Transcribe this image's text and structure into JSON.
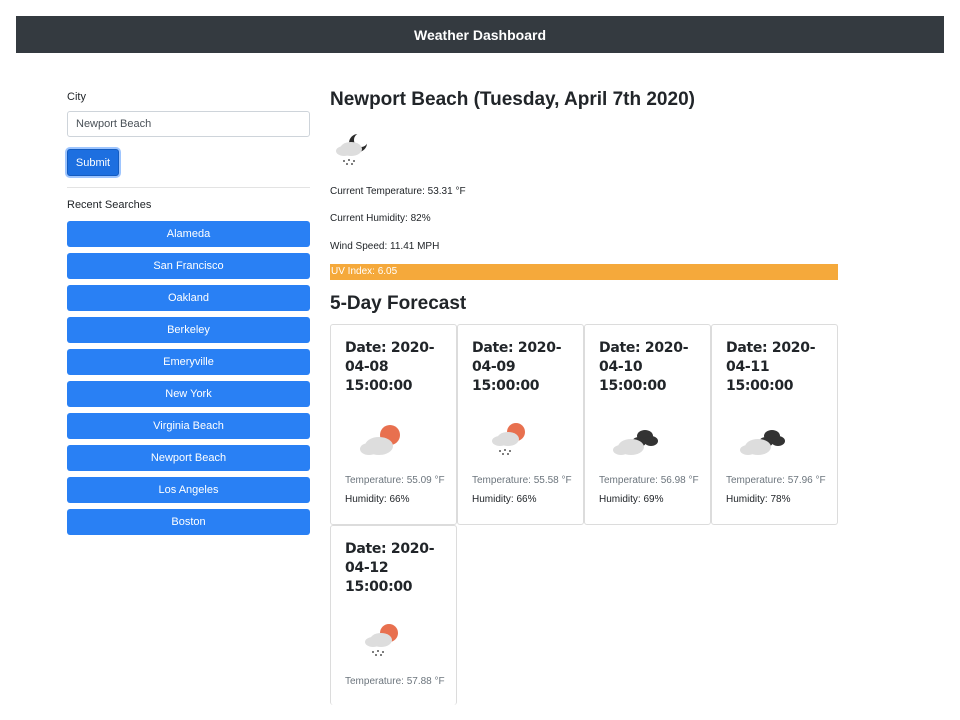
{
  "navbar": {
    "title": "Weather Dashboard"
  },
  "search": {
    "label": "City",
    "value": "Newport Beach",
    "submit_label": "Submit",
    "recent_title": "Recent Searches",
    "recent": [
      "Alameda",
      "San Francisco",
      "Oakland",
      "Berkeley",
      "Emeryville",
      "New York",
      "Virginia Beach",
      "Newport Beach",
      "Los Angeles",
      "Boston"
    ]
  },
  "current": {
    "title": "Newport Beach (Tuesday, April 7th 2020)",
    "icon": "rain-cloud-night-icon",
    "temperature": "Current Temperature: 53.31 °F",
    "humidity": "Current Humidity: 82%",
    "wind": "Wind Speed: 11.41 MPH",
    "uv": "UV Index: 6.05"
  },
  "forecast": {
    "title": "5-Day Forecast",
    "days": [
      {
        "date": "Date: 2020-04-08 15:00:00",
        "icon": "partly-cloudy-icon",
        "temp": "Temperature: 55.09 °F",
        "humidity": "Humidity: 66%"
      },
      {
        "date": "Date: 2020-04-09 15:00:00",
        "icon": "rain-cloud-sun-icon",
        "temp": "Temperature: 55.58 °F",
        "humidity": "Humidity: 66%"
      },
      {
        "date": "Date: 2020-04-10 15:00:00",
        "icon": "broken-clouds-icon",
        "temp": "Temperature: 56.98 °F",
        "humidity": "Humidity: 69%"
      },
      {
        "date": "Date: 2020-04-11 15:00:00",
        "icon": "broken-clouds-icon",
        "temp": "Temperature: 57.96 °F",
        "humidity": "Humidity: 78%"
      },
      {
        "date": "Date: 2020-04-12 15:00:00",
        "icon": "rain-cloud-sun-icon",
        "temp": "Temperature: 57.88 °F",
        "humidity": ""
      }
    ]
  },
  "colors": {
    "navbar": "#343a40",
    "button": "#2980f4",
    "uv": "#f5a93b"
  }
}
